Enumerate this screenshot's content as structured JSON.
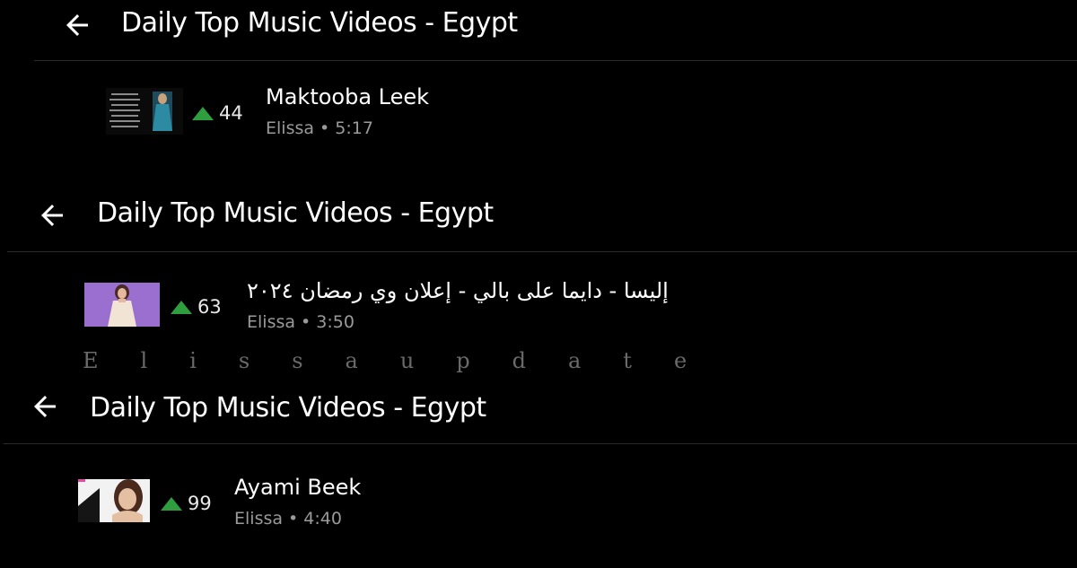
{
  "panels": [
    {
      "title": "Daily Top Music Videos - Egypt",
      "item": {
        "rank": "44",
        "title": "Maktooba Leek",
        "meta": "Elissa • 5:17"
      }
    },
    {
      "title": "Daily Top Music Videos - Egypt",
      "item": {
        "rank": "63",
        "title": "إليسا - دايما على بالي - إعلان وي رمضان ٢٠٢٤",
        "meta": "Elissa • 3:50"
      }
    },
    {
      "title": "Daily Top Music Videos - Egypt",
      "item": {
        "rank": "99",
        "title": "Ayami Beek",
        "meta": "Elissa • 4:40"
      }
    }
  ],
  "watermark": "Elissaupdate",
  "colors": {
    "background": "#000000",
    "rank_up": "#2e9e3e",
    "divider": "#2b2b2b",
    "meta": "#9a9a9a"
  },
  "icons": {
    "back": "arrow-left-icon",
    "rank": "triangle-up-icon"
  }
}
